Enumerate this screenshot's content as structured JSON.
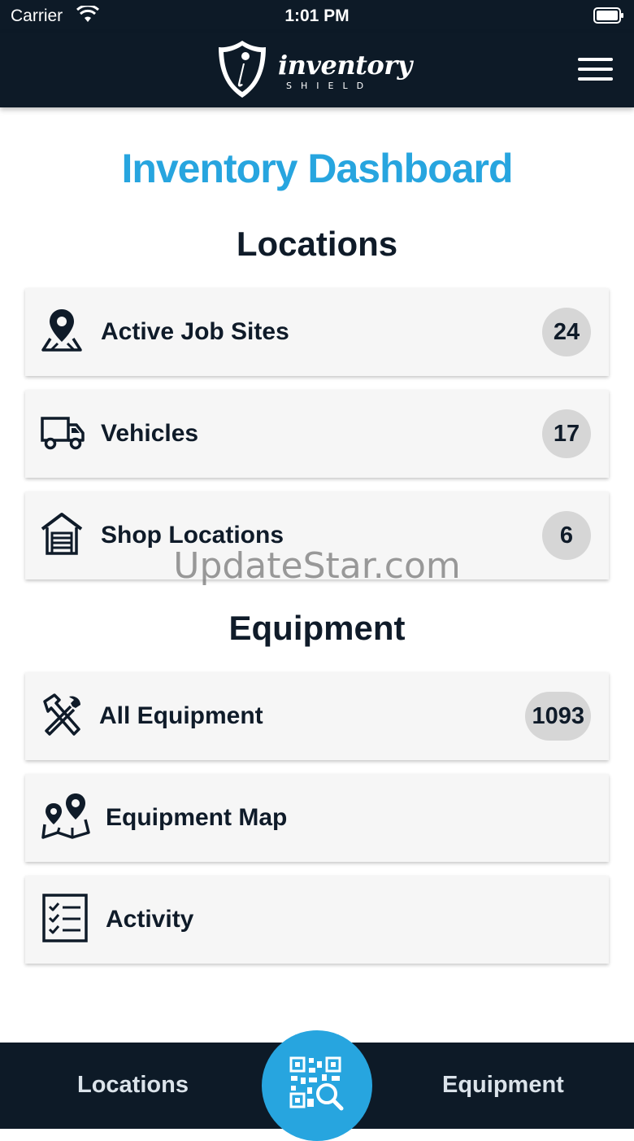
{
  "status_bar": {
    "carrier": "Carrier",
    "time": "1:01 PM"
  },
  "header": {
    "logo_word": "inventory",
    "logo_sub": "SHIELD",
    "menu_icon": "hamburger-menu-icon"
  },
  "page_title": "Inventory Dashboard",
  "locations": {
    "title": "Locations",
    "items": [
      {
        "label": "Active Job Sites",
        "count": "24",
        "icon": "map-pin-icon"
      },
      {
        "label": "Vehicles",
        "count": "17",
        "icon": "truck-icon"
      },
      {
        "label": "Shop Locations",
        "count": "6",
        "icon": "warehouse-icon"
      }
    ]
  },
  "equipment": {
    "title": "Equipment",
    "items": [
      {
        "label": "All Equipment",
        "count": "1093",
        "icon": "tools-icon"
      },
      {
        "label": "Equipment Map",
        "icon": "map-markers-icon"
      },
      {
        "label": "Activity",
        "icon": "checklist-icon"
      }
    ]
  },
  "watermark": "UpdateStar.com",
  "tab_bar": {
    "left": "Locations",
    "right": "Equipment",
    "center_icon": "qr-scan-icon"
  },
  "colors": {
    "navy": "#0d1a27",
    "accent": "#27a5df",
    "badge": "#d6d6d6",
    "card": "#f6f6f6"
  }
}
